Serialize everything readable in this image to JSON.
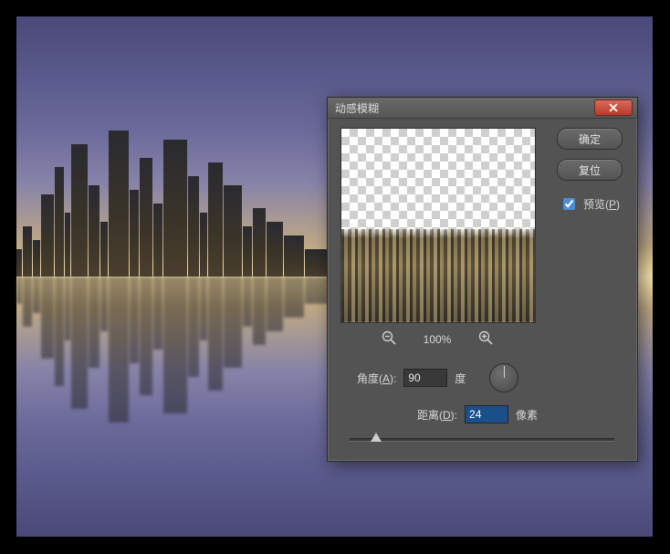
{
  "dialog": {
    "title": "动感模糊",
    "ok_label": "确定",
    "reset_label": "复位",
    "preview_label": "预览(",
    "preview_key": "P",
    "preview_suffix": ")",
    "preview_checked": true,
    "zoom_pct": "100%",
    "angle_label": "角度(",
    "angle_key": "A",
    "angle_suffix": "):",
    "angle_value": "90",
    "angle_unit": "度",
    "distance_label": "距离(",
    "distance_key": "D",
    "distance_suffix": "):",
    "distance_value": "24",
    "distance_unit": "像素"
  },
  "icons": {
    "close": "close-icon",
    "zoom_out": "zoom-out-icon",
    "zoom_in": "zoom-in-icon"
  }
}
